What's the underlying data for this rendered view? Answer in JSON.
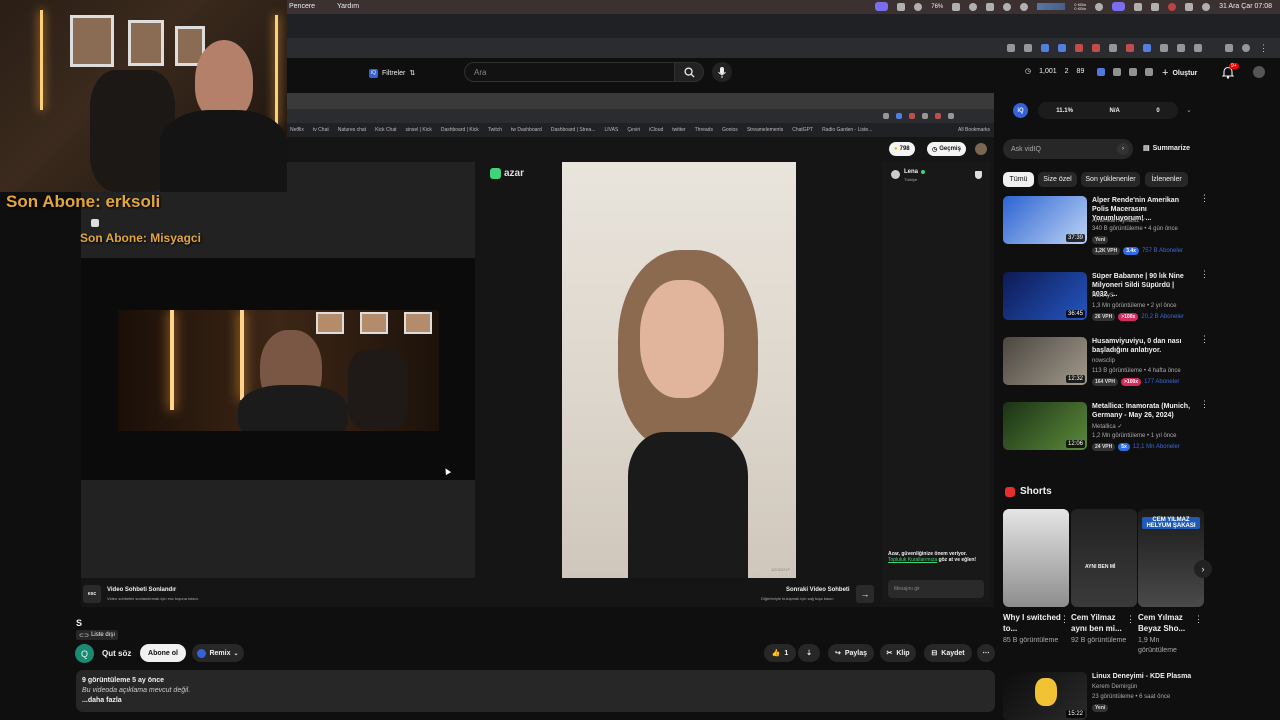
{
  "menubar": {
    "items": [
      "Pencere",
      "Yardım"
    ],
    "battery": "76%",
    "net_up": "0 KB/s",
    "net_down": "0 KB/s",
    "clock": "31 Ara Çar 07:08"
  },
  "yt": {
    "filters_label": "Filtreler",
    "search_placeholder": "Ara",
    "stats": [
      "1,001",
      "2",
      "89"
    ],
    "create_label": "Oluştur",
    "notif_count": "9+"
  },
  "overlay": {
    "sub1": "Son Abone: erksoli",
    "sub2": "Son Abone: Misyagci"
  },
  "nested_bookmarks": [
    "Netflix",
    "tv Chat",
    "Natures chat",
    "Kick Chat",
    "sinsel | Kick",
    "Dashboard | Kick",
    "Twitch",
    "tw Dashboard",
    "Dashboard | Strea...",
    "LIVAS",
    "Çeviri",
    "iCloud",
    "twitter",
    "Threads",
    "Gonios",
    "Streamelements",
    "ChatGPT",
    "Radio Garden - Liste..."
  ],
  "nested_bm_right": "All Bookmarks",
  "azar": {
    "logo": "azar",
    "gems": "798",
    "history": "Geçmiş",
    "peer_name": "Lena",
    "peer_country": "Türkiye",
    "safety_title": "Azar, güvenliğinize önem veriyor.",
    "safety_link": "Topluluk Kurallarımıza",
    "safety_rest": "göz at ve eğlen!",
    "message_placeholder": "Mesajını gir",
    "esc_key": "esc",
    "end_title": "Video Sohbeti Sonlandır",
    "end_sub": "Video sohbetini sonlandırmak için esc tuşuna basın.",
    "next_title": "Sonraki Video Sohbeti",
    "next_sub": "Diğerleriyle buluşmak için sağ tuşa basın",
    "watermark": "AZ05321F"
  },
  "iq": {
    "pct": "11.1%",
    "na": "N/A",
    "zero": "0"
  },
  "askbar": {
    "placeholder": "Ask vidIQ",
    "summarize": "Summarize"
  },
  "chips": [
    "Tümü",
    "Size özel",
    "Son yüklenenler",
    "İzlenenler"
  ],
  "videos": [
    {
      "title": "Alper Rende'nin Amerikan Polis Macerasını Yorumluyorum! ...",
      "channel": "Amerikalı Aynasiz",
      "meta": "340 B görüntüleme • 4 gün önce",
      "dur": "37:39",
      "new": "Yeni",
      "vph": "1,2K VPH",
      "x": "3.4x",
      "subs": "757 B Aboneler",
      "thumb": "#3a6fd8"
    },
    {
      "title": "Süper Babanne | 90 lık Nine Milyoneri Sildi Süpürdü | 1032. ...",
      "channel": "HanAyS",
      "meta": "1,3 Mn görüntüleme • 2 yıl önce",
      "dur": "36:45",
      "new": "",
      "vph": "26 VPH",
      "x": ">100x",
      "subs": "20,2 B Aboneler",
      "thumb": "#1d2a6e"
    },
    {
      "title": "Husamviyuviyu, 0 dan nası başladığını anlatıyor.",
      "channel": "nowsclip",
      "meta": "113 B görüntüleme • 4 hafta önce",
      "dur": "12:32",
      "new": "",
      "vph": "164 VPH",
      "x": ">100x",
      "subs": "177 Aboneler",
      "thumb": "#6f6a62"
    },
    {
      "title": "Metallica: Inamorata (Munich, Germany - May 26, 2024)",
      "channel": "Metallica",
      "meta": "1,2 Mn görüntüleme • 1 yıl önce",
      "dur": "12:06",
      "new": "",
      "vph": "24 VPH",
      "x": "5x",
      "subs": "12,1 Mn Aboneler",
      "thumb": "#2b4a22"
    }
  ],
  "shorts_label": "Shorts",
  "shorts": [
    {
      "title": "Why I switched to...",
      "meta": "85 B görüntüleme"
    },
    {
      "title": "Cem Yilmaz aynı ben mi...",
      "meta": "92 B görüntüleme",
      "overlay": "AYNI BEN Mİ"
    },
    {
      "title": "Cem Yılmaz Beyaz Sho...",
      "meta": "1,9 Mn görüntüleme",
      "overlay": "CEM YILMAZ HELYUM ŞAKASI"
    }
  ],
  "last_video": {
    "title": "Linux Deneyimi - KDE Plasma",
    "channel": "Kerem Demirgün",
    "meta": "23 görüntüleme • 6 saat önce",
    "dur": "15:22",
    "new": "Yeni"
  },
  "main": {
    "video_title": "S",
    "list_tag": "Liste dışı",
    "channel_initial": "Q",
    "channel_name": "Qut söz",
    "subscribe": "Abone ol",
    "remix": "Remix",
    "likes": "1",
    "share": "Paylaş",
    "clip": "Klip",
    "save": "Kaydet",
    "desc_stats": "9 görüntüleme  5 ay önce",
    "desc_empty": "Bu videoda açıklama mevcut değil.",
    "desc_more": "...daha fazla"
  }
}
